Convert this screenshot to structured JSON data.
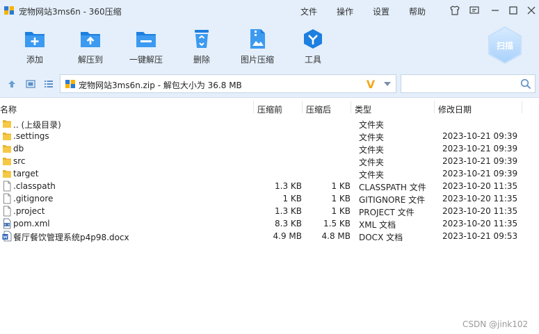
{
  "window": {
    "title": "宠物网站3ms6n - 360压缩",
    "menu": [
      "文件",
      "操作",
      "设置",
      "帮助"
    ],
    "controls": [
      "skin-icon",
      "feedback-icon",
      "minimize-icon",
      "maximize-icon",
      "close-icon"
    ]
  },
  "toolbar": {
    "items": [
      {
        "label": "添加",
        "icon": "add-folder-icon"
      },
      {
        "label": "解压到",
        "icon": "extract-folder-icon"
      },
      {
        "label": "一键解压",
        "icon": "one-click-extract-icon"
      },
      {
        "label": "删除",
        "icon": "recycle-bin-icon"
      },
      {
        "label": "图片压缩",
        "icon": "image-compress-icon"
      },
      {
        "label": "工具",
        "icon": "tools-icon"
      }
    ],
    "scan_label": "扫描"
  },
  "address": {
    "path": "宠物网站3ms6n.zip - 解包大小为 36.8 MB",
    "badge": "V",
    "search_placeholder": ""
  },
  "columns": {
    "name": "名称",
    "packed": "压缩前",
    "size": "压缩后",
    "type": "类型",
    "modified": "修改日期"
  },
  "files": [
    {
      "name": ".. (上级目录)",
      "packed": "",
      "size": "",
      "type": "文件夹",
      "date": "",
      "icon": "folder"
    },
    {
      "name": ".settings",
      "packed": "",
      "size": "",
      "type": "文件夹",
      "date": "2023-10-21 09:39",
      "icon": "folder"
    },
    {
      "name": "db",
      "packed": "",
      "size": "",
      "type": "文件夹",
      "date": "2023-10-21 09:39",
      "icon": "folder"
    },
    {
      "name": "src",
      "packed": "",
      "size": "",
      "type": "文件夹",
      "date": "2023-10-21 09:39",
      "icon": "folder"
    },
    {
      "name": "target",
      "packed": "",
      "size": "",
      "type": "文件夹",
      "date": "2023-10-21 09:39",
      "icon": "folder"
    },
    {
      "name": ".classpath",
      "packed": "1.3 KB",
      "size": "1 KB",
      "type": "CLASSPATH 文件",
      "date": "2023-10-20 11:35",
      "icon": "file"
    },
    {
      "name": ".gitignore",
      "packed": "1 KB",
      "size": "1 KB",
      "type": "GITIGNORE 文件",
      "date": "2023-10-20 11:35",
      "icon": "file"
    },
    {
      "name": ".project",
      "packed": "1.3 KB",
      "size": "1 KB",
      "type": "PROJECT 文件",
      "date": "2023-10-20 11:35",
      "icon": "file"
    },
    {
      "name": "pom.xml",
      "packed": "8.3 KB",
      "size": "1.5 KB",
      "type": "XML 文档",
      "date": "2023-10-20 11:35",
      "icon": "xml"
    },
    {
      "name": "餐厅餐饮管理系统p4p98.docx",
      "packed": "4.9 MB",
      "size": "4.8 MB",
      "type": "DOCX 文档",
      "date": "2023-10-21 09:53",
      "icon": "docx"
    }
  ],
  "watermark": "CSDN @jink102",
  "colors": {
    "chrome": "#e4effb",
    "accent": "#2b8fe0",
    "folder": "#f2c230"
  }
}
